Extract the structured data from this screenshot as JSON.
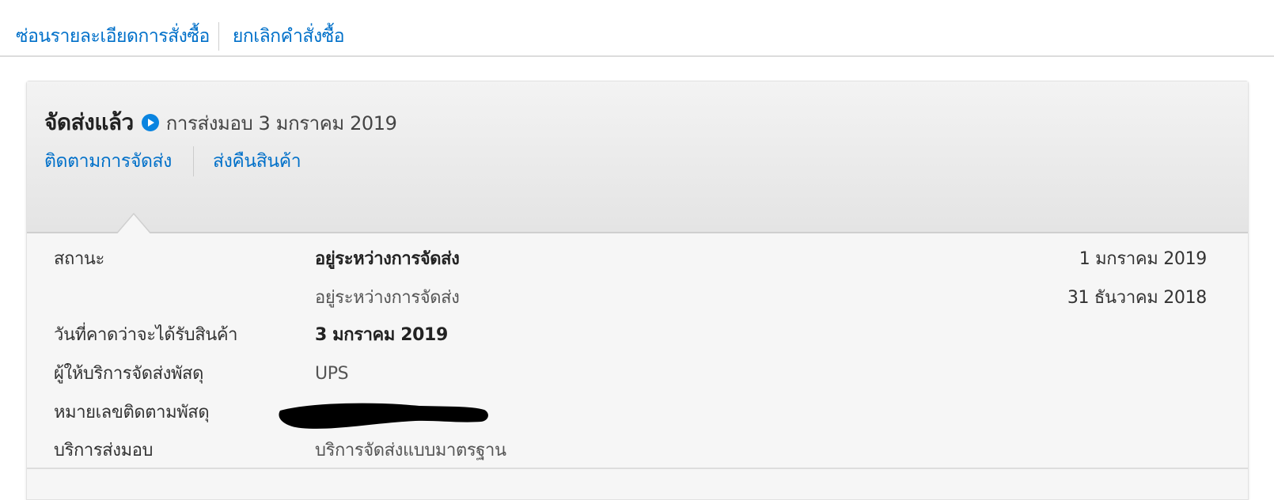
{
  "top_links": {
    "hide_details": "ซ่อนรายละเอียดการสั่งซื้อ",
    "cancel_order": "ยกเลิกคำสั่งซื้อ"
  },
  "shipment": {
    "status_title": "จัดส่งแล้ว",
    "status_icon": "play-circle-icon",
    "delivery_text": "การส่งมอบ 3 มกราคม 2019",
    "track_link": "ติดตามการจัดส่ง",
    "return_link": "ส่งคืนสินค้า"
  },
  "details": {
    "status_label": "สถานะ",
    "status_events": [
      {
        "text": "อยู่ระหว่างการจัดส่ง",
        "date": "1 มกราคม 2019"
      },
      {
        "text": "อยู่ระหว่างการจัดส่ง",
        "date": "31 ธันวาคม 2018"
      }
    ],
    "expected_label": "วันที่คาดว่าจะได้รับสินค้า",
    "expected_value": "3 มกราคม 2019",
    "carrier_label": "ผู้ให้บริการจัดส่งพัสดุ",
    "carrier_value": "UPS",
    "tracking_label": "หมายเลขติดตามพัสดุ",
    "tracking_value_redacted": true,
    "service_label": "บริการส่งมอบ",
    "service_value": "บริการจัดส่งแบบมาตรฐาน"
  },
  "colors": {
    "link": "#0070c9",
    "accent_icon": "#0a84e0",
    "header_bg": "#e9e9e9",
    "body_bg": "#f6f6f6"
  }
}
